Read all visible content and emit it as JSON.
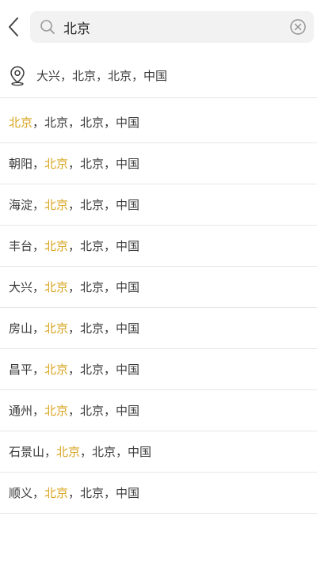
{
  "search": {
    "value": "北京",
    "placeholder": ""
  },
  "icons": {
    "back": "chevron-left-icon",
    "search": "search-icon",
    "clear": "clear-circle-icon",
    "location": "location-pin-icon"
  },
  "colors": {
    "highlight": "#d9a520",
    "text": "#3a3a3a",
    "search_bg": "#f2f2f2",
    "divider": "#e6e6e6"
  },
  "current_location": {
    "text": "大兴，北京，北京，中国"
  },
  "results": [
    {
      "pre": "",
      "hl": "北京",
      "post": "，北京，北京，中国"
    },
    {
      "pre": "朝阳，",
      "hl": "北京",
      "post": "，北京，中国"
    },
    {
      "pre": "海淀，",
      "hl": "北京",
      "post": "，北京，中国"
    },
    {
      "pre": "丰台，",
      "hl": "北京",
      "post": "，北京，中国"
    },
    {
      "pre": "大兴，",
      "hl": "北京",
      "post": "，北京，中国"
    },
    {
      "pre": "房山，",
      "hl": "北京",
      "post": "，北京，中国"
    },
    {
      "pre": "昌平，",
      "hl": "北京",
      "post": "，北京，中国"
    },
    {
      "pre": "通州，",
      "hl": "北京",
      "post": "，北京，中国"
    },
    {
      "pre": "石景山，",
      "hl": "北京",
      "post": "，北京，中国"
    },
    {
      "pre": "顺义，",
      "hl": "北京",
      "post": "，北京，中国"
    }
  ]
}
